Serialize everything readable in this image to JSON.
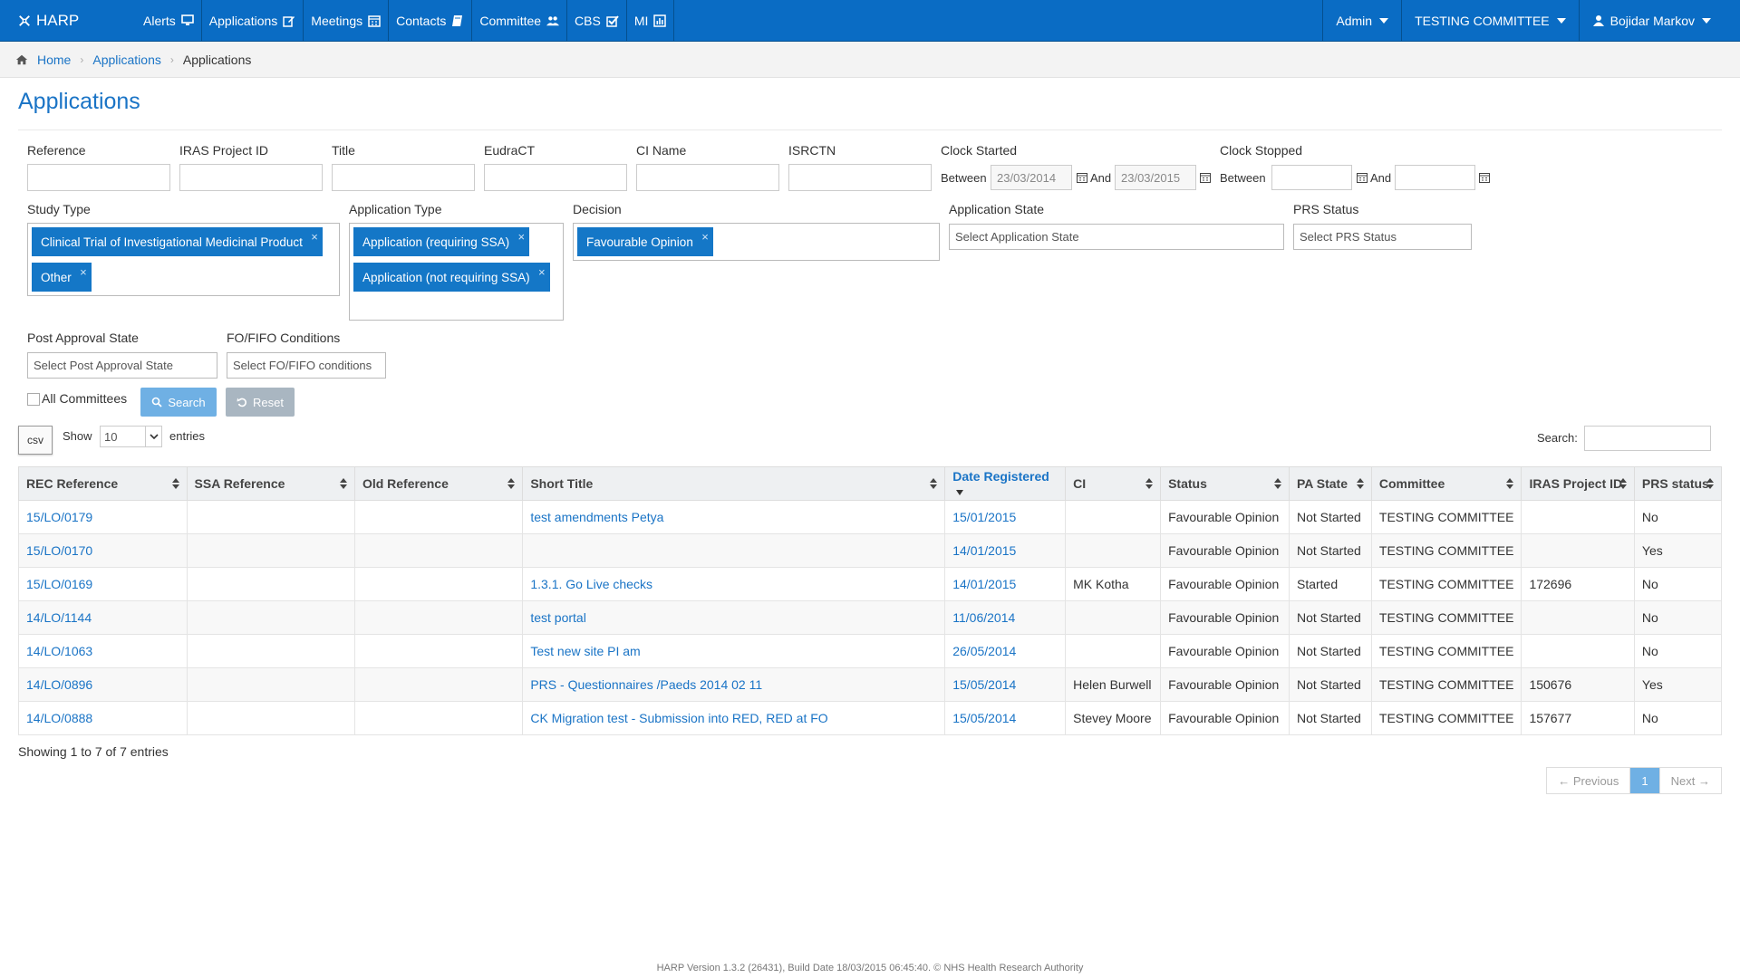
{
  "app": {
    "brand": "HARP"
  },
  "nav": {
    "items": [
      {
        "label": "Alerts",
        "icon": "monitor-icon"
      },
      {
        "label": "Applications",
        "icon": "edit-icon"
      },
      {
        "label": "Meetings",
        "icon": "calendar-icon"
      },
      {
        "label": "Contacts",
        "icon": "book-icon"
      },
      {
        "label": "Committee",
        "icon": "users-icon"
      },
      {
        "label": "CBS",
        "icon": "check-square-icon"
      },
      {
        "label": "MI",
        "icon": "bar-chart-icon"
      }
    ],
    "admin": "Admin",
    "committee": "TESTING COMMITTEE",
    "user": "Bojidar Markov"
  },
  "breadcrumb": {
    "home": "Home",
    "applications": "Applications",
    "current": "Applications"
  },
  "page": {
    "title": "Applications"
  },
  "filters": {
    "reference": "Reference",
    "iras": "IRAS Project ID",
    "title": "Title",
    "eudract": "EudraCT",
    "ci_name": "CI Name",
    "isrctn": "ISRCTN",
    "clock_started": "Clock Started",
    "clock_stopped": "Clock Stopped",
    "between": "Between",
    "and": "And",
    "clock_started_from": "23/03/2014",
    "clock_started_to": "23/03/2015",
    "study_type": "Study Type",
    "study_type_tags": [
      "Clinical Trial of Investigational Medicinal Product",
      "Other"
    ],
    "application_type": "Application Type",
    "application_type_tags": [
      "Application (requiring SSA)",
      "Application (not requiring SSA)"
    ],
    "decision": "Decision",
    "decision_tags": [
      "Favourable Opinion"
    ],
    "application_state": "Application State",
    "application_state_placeholder": "Select Application State",
    "prs_status": "PRS Status",
    "prs_status_placeholder": "Select PRS Status",
    "post_approval_state": "Post Approval State",
    "post_approval_placeholder": "Select Post Approval State",
    "fo_fifo": "FO/FIFO Conditions",
    "fo_fifo_placeholder": "Select FO/FIFO conditions",
    "all_committees": "All Committees",
    "search_btn": "Search",
    "reset_btn": "Reset"
  },
  "table_controls": {
    "csv": "csv",
    "show": "Show",
    "entries_value": "10",
    "entries": "entries",
    "search_label": "Search:"
  },
  "table": {
    "headers": [
      "REC Reference",
      "SSA Reference",
      "Old Reference",
      "Short Title",
      "Date Registered",
      "CI",
      "Status",
      "PA State",
      "Committee",
      "IRAS Project ID",
      "PRS status"
    ],
    "rows": [
      [
        "15/LO/0179",
        "",
        "",
        "test amendments Petya",
        "15/01/2015",
        "",
        "Favourable Opinion",
        "Not Started",
        "TESTING COMMITTEE",
        "",
        "No"
      ],
      [
        "15/LO/0170",
        "",
        "",
        "",
        "14/01/2015",
        "",
        "Favourable Opinion",
        "Not Started",
        "TESTING COMMITTEE",
        "",
        "Yes"
      ],
      [
        "15/LO/0169",
        "",
        "",
        "1.3.1. Go Live checks",
        "14/01/2015",
        "MK Kotha",
        "Favourable Opinion",
        "Started",
        "TESTING COMMITTEE",
        "172696",
        "No"
      ],
      [
        "14/LO/1144",
        "",
        "",
        "test portal",
        "11/06/2014",
        "",
        "Favourable Opinion",
        "Not Started",
        "TESTING COMMITTEE",
        "",
        "No"
      ],
      [
        "14/LO/1063",
        "",
        "",
        "Test new site PI am",
        "26/05/2014",
        "",
        "Favourable Opinion",
        "Not Started",
        "TESTING COMMITTEE",
        "",
        "No"
      ],
      [
        "14/LO/0896",
        "",
        "",
        "PRS - Questionnaires /Paeds 2014 02 11",
        "15/05/2014",
        "Helen Burwell",
        "Favourable Opinion",
        "Not Started",
        "TESTING COMMITTEE",
        "150676",
        "Yes"
      ],
      [
        "14/LO/0888",
        "",
        "",
        "CK Migration test - Submission into RED, RED at FO",
        "15/05/2014",
        "Stevey Moore",
        "Favourable Opinion",
        "Not Started",
        "TESTING COMMITTEE",
        "157677",
        "No"
      ]
    ],
    "info": "Showing 1 to 7 of 7 entries"
  },
  "pager": {
    "prev": "← Previous",
    "page": "1",
    "next": "Next →"
  },
  "footer": "HARP Version 1.3.2 (26431), Build Date 18/03/2015 06:45:40. © NHS Health Research Authority"
}
